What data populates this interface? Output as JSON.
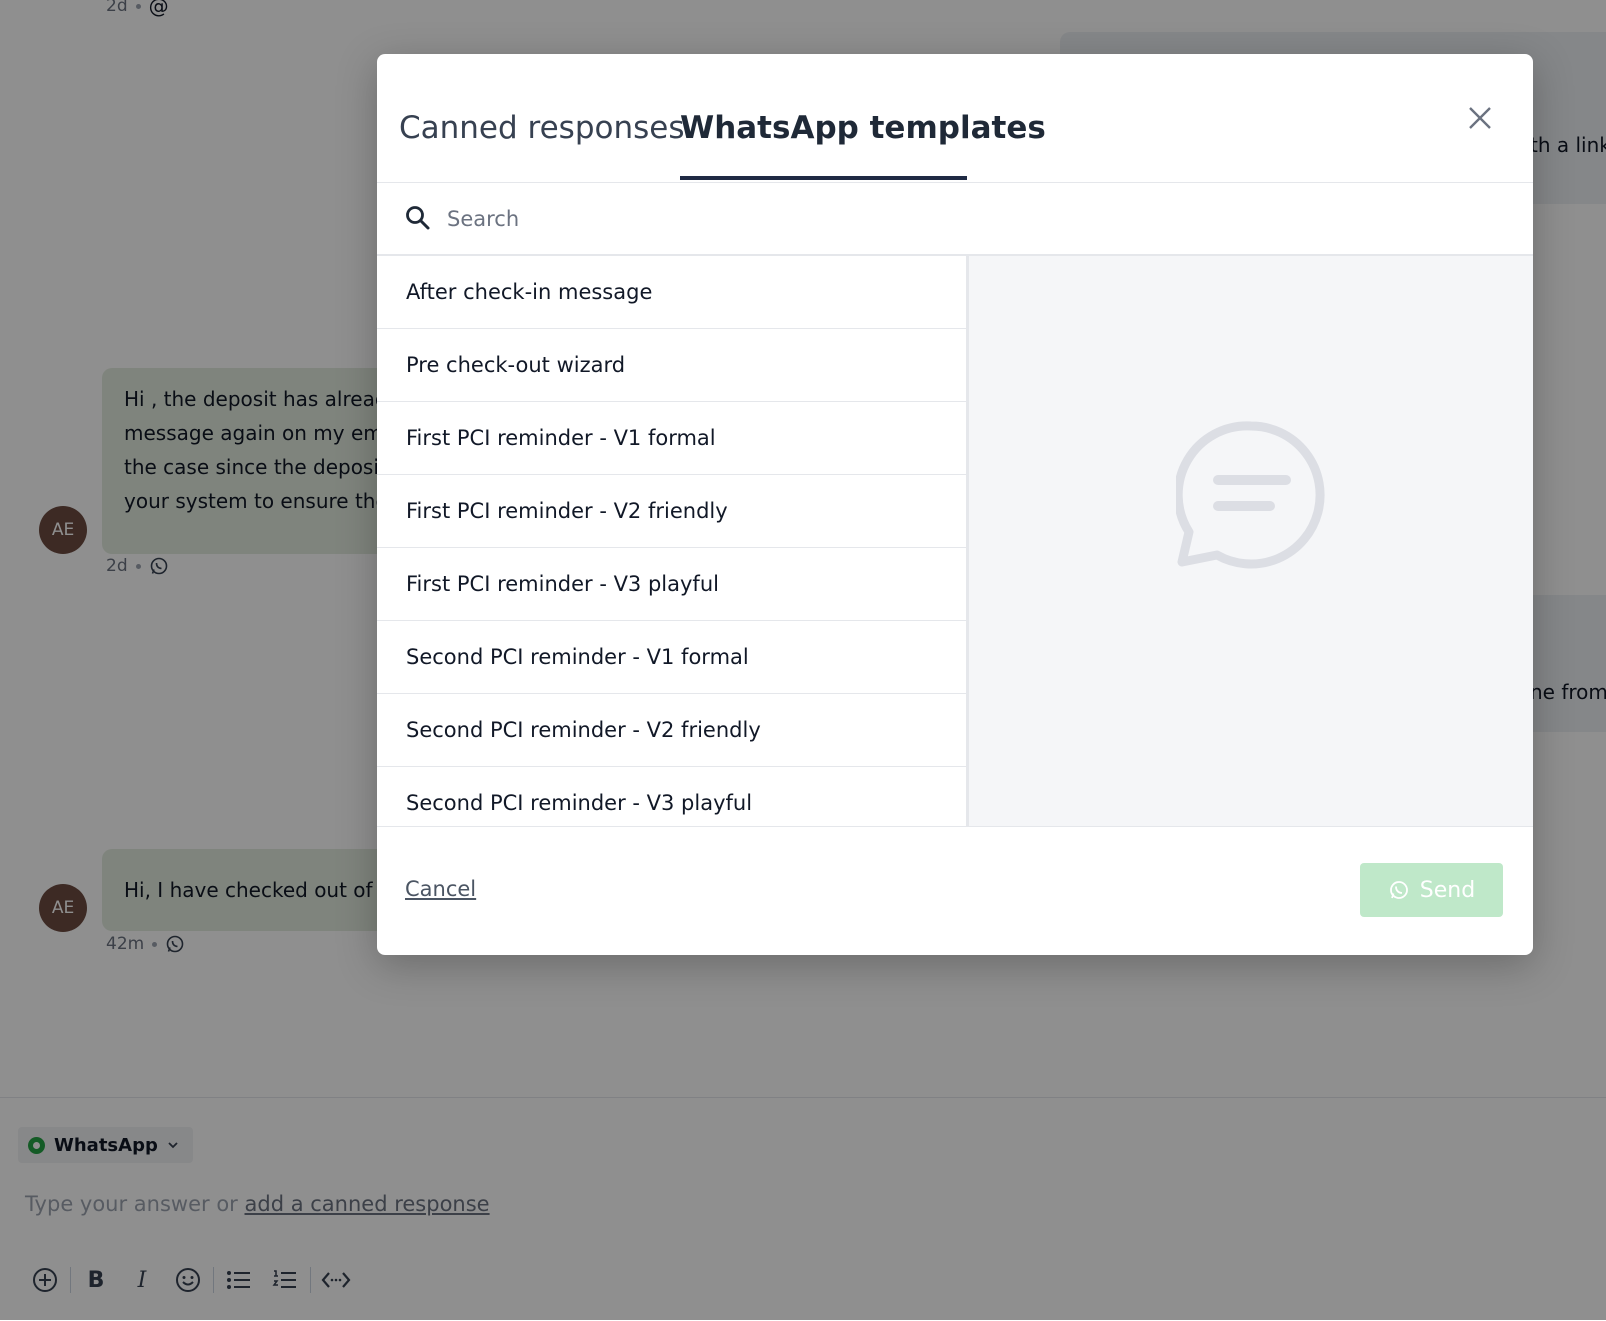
{
  "conversation": {
    "top_meta": {
      "time": "2d",
      "channel_symbol": "@"
    },
    "outgoing_1": {
      "text": "th a link"
    },
    "incoming_1": {
      "avatar": "AE",
      "lines": [
        "Hi , the deposit has alread",
        "message again on my ema",
        "the case since the deposit",
        "your system to ensure the"
      ],
      "time": "2d"
    },
    "outgoing_2": {
      "text": "ne from",
      "mark": "."
    },
    "incoming_2": {
      "avatar": "AE",
      "text": "Hi, I have checked out of t",
      "time": "42m"
    }
  },
  "composer": {
    "channel_label": "WhatsApp",
    "hint_text": "Type your answer or",
    "hint_link": "add a canned response",
    "tools": [
      "plus-circle-icon",
      "bold-icon",
      "italic-icon",
      "emoji-icon",
      "bullet-list-icon",
      "numbered-list-icon",
      "code-icon"
    ]
  },
  "modal": {
    "tabs": [
      {
        "label": "Canned responses",
        "active": false
      },
      {
        "label": "WhatsApp templates",
        "active": true
      }
    ],
    "search_placeholder": "Search",
    "search_value": "",
    "templates": [
      "After check-in message",
      "Pre check-out wizard",
      "First PCI reminder - V1 formal",
      "First PCI reminder - V2 friendly",
      "First PCI reminder - V3 playful",
      "Second PCI reminder - V1 formal",
      "Second PCI reminder - V2 friendly",
      "Second PCI reminder - V3 playful"
    ],
    "cancel_label": "Cancel",
    "send_label": "Send",
    "colors": {
      "send_disabled": "#bfe8c9",
      "tab_underline": "#1f2a44",
      "preview_bg": "#f5f6f8"
    }
  }
}
